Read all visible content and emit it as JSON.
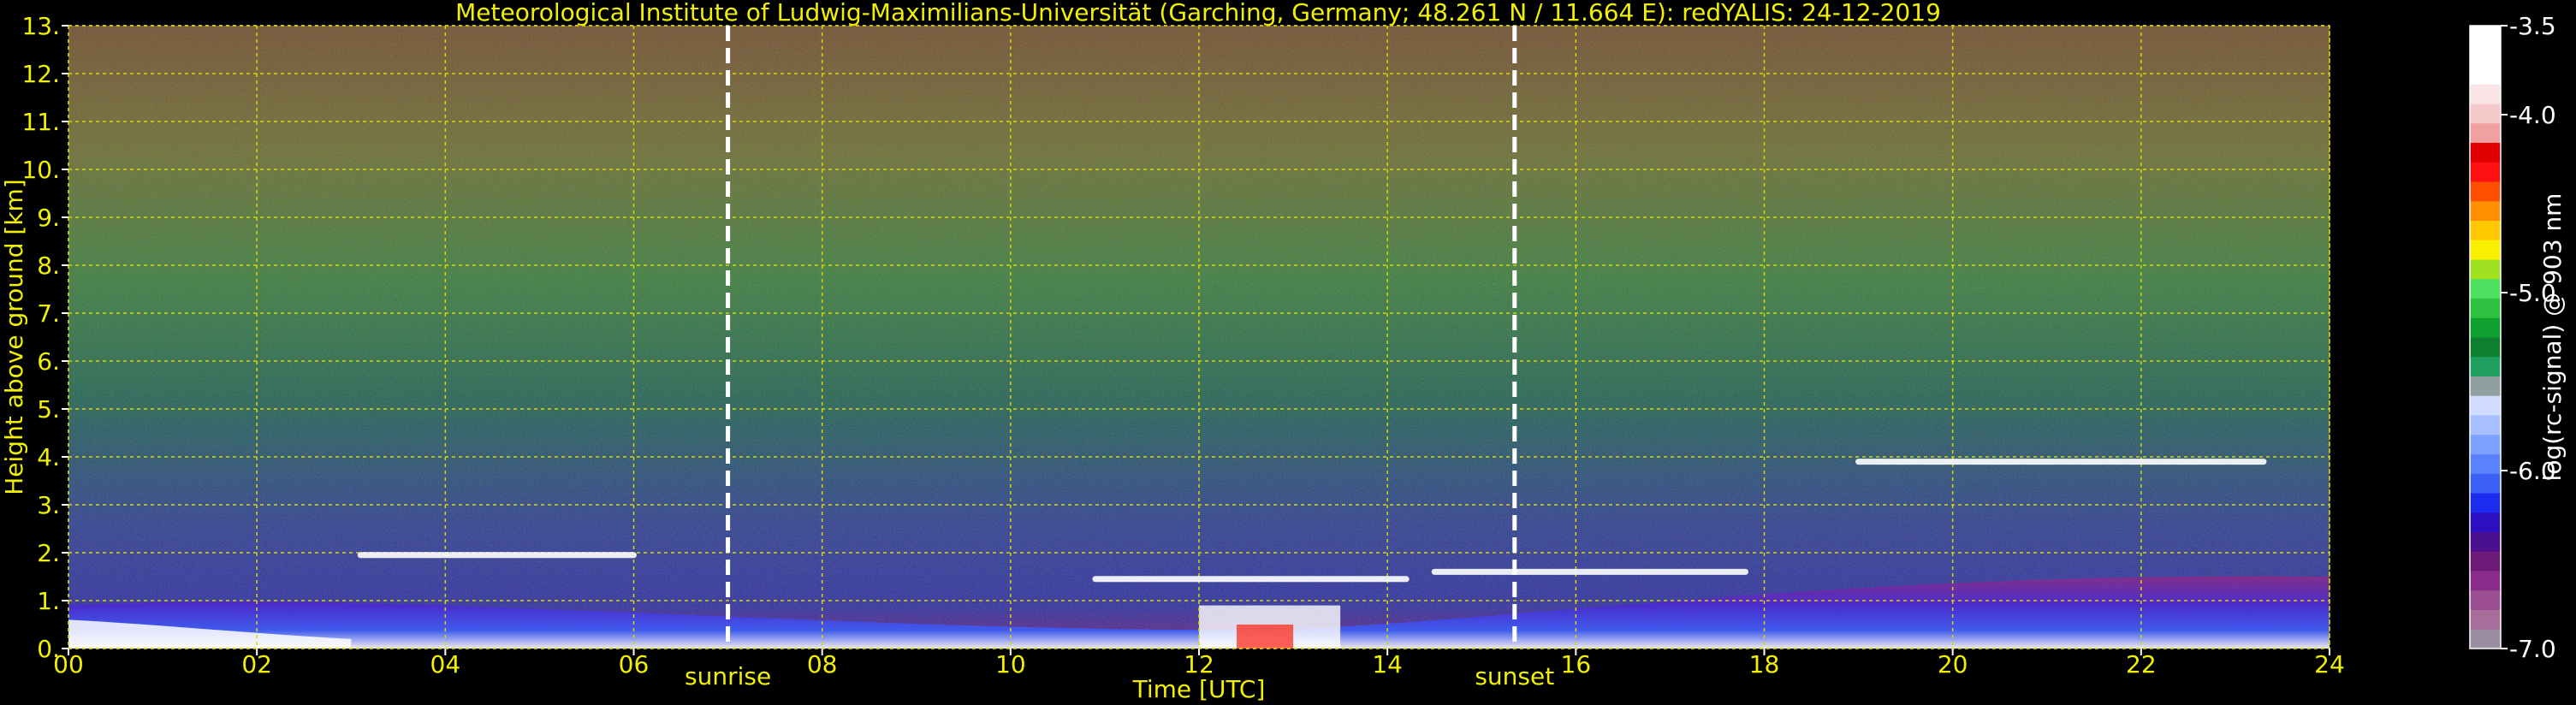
{
  "title": "Meteorological Institute of Ludwig-Maximilians-Universität (Garching, Germany; 48.261 N / 11.664 E):    redYALIS: 24-12-2019",
  "colors": {
    "background": "#000000",
    "axis_text": "#f0f000",
    "grid": "#d8d800",
    "event_line": "#ffffff",
    "colorbar_text": "#ffffff"
  },
  "chart_data": {
    "type": "heatmap",
    "xlabel": "Time [UTC]",
    "ylabel": "Height above ground [km]",
    "xlim": [
      0,
      24
    ],
    "ylim": [
      0,
      13
    ],
    "x_ticks": [
      0,
      2,
      4,
      6,
      8,
      10,
      12,
      14,
      16,
      18,
      20,
      22,
      24
    ],
    "x_tick_labels": [
      "00",
      "02",
      "04",
      "06",
      "08",
      "10",
      "12",
      "14",
      "16",
      "18",
      "20",
      "22",
      "24"
    ],
    "y_ticks": [
      0,
      1,
      2,
      3,
      4,
      5,
      6,
      7,
      8,
      9,
      10,
      11,
      12,
      13
    ],
    "y_tick_labels": [
      "0.",
      "1.",
      "2.",
      "3.",
      "4.",
      "5.",
      "6.",
      "7.",
      "8.",
      "9.",
      "10.",
      "11.",
      "12.",
      "13."
    ],
    "grid": true,
    "event_lines": [
      {
        "time": 7.0,
        "label": "sunrise"
      },
      {
        "time": 15.35,
        "label": "sunset"
      }
    ],
    "colorbar": {
      "label": "log(rc-signal) @ 903 nm",
      "range": [
        -7.0,
        -3.5
      ],
      "ticks": [
        -3.5,
        -4.0,
        -5.0,
        -6.0,
        -7.0
      ],
      "tick_labels": [
        "-3.5",
        "-4.0",
        "-5.0",
        "-6.0",
        "-7.0"
      ],
      "colors": [
        "#9a8fa0",
        "#a86e9a",
        "#9c4e92",
        "#8a2d8a",
        "#6e1a78",
        "#4a1090",
        "#2a10c0",
        "#1e2cf0",
        "#3c5ff8",
        "#5a82ff",
        "#7ea2ff",
        "#a8c0ff",
        "#cfdcff",
        "#8ea0a0",
        "#1fa060",
        "#0e8030",
        "#10a030",
        "#30c040",
        "#50e060",
        "#a0e020",
        "#f8f000",
        "#ffc800",
        "#ff9000",
        "#ff5000",
        "#ff1010",
        "#e00000",
        "#f0a0a0",
        "#f4c8c8",
        "#f8e4e4",
        "#ffffff",
        "#ffffff",
        "#ffffff"
      ]
    },
    "cloud_layers": [
      {
        "t0": 3.1,
        "t1": 6.0,
        "h": 1.95
      },
      {
        "t0": 10.9,
        "t1": 14.2,
        "h": 1.45
      },
      {
        "t0": 14.5,
        "t1": 17.8,
        "h": 1.6
      },
      {
        "t0": 19.0,
        "t1": 23.3,
        "h": 3.9
      }
    ]
  }
}
